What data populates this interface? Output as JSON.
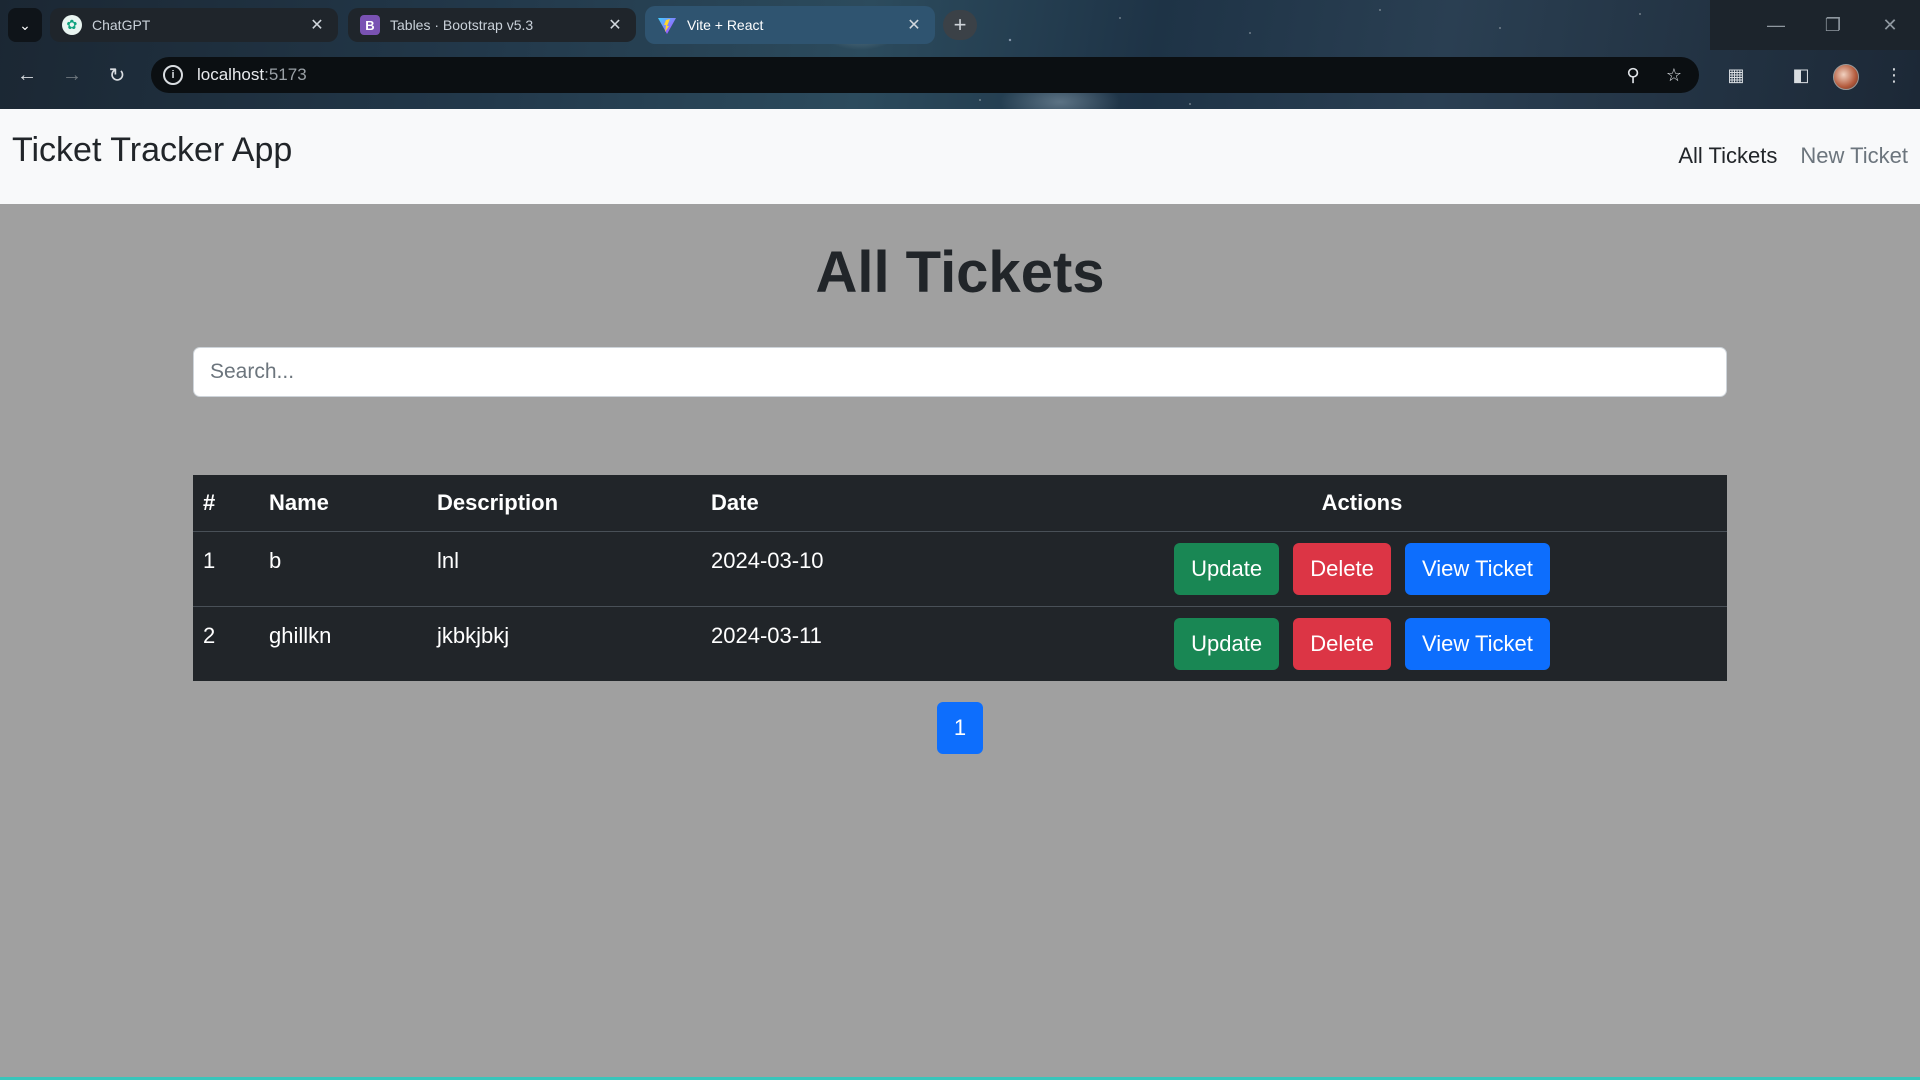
{
  "browser": {
    "tabs": [
      {
        "title": "ChatGPT",
        "favicon": "chatgpt-icon"
      },
      {
        "title": "Tables · Bootstrap v5.3",
        "favicon": "bootstrap-icon",
        "favicon_text": "B"
      },
      {
        "title": "Vite + React",
        "favicon": "vite-icon"
      }
    ],
    "url_host": "localhost",
    "url_port": ":5173"
  },
  "app": {
    "brand": "Ticket Tracker App",
    "nav": {
      "all_tickets": "All Tickets",
      "new_ticket": "New Ticket"
    },
    "page_title": "All Tickets",
    "search": {
      "placeholder": "Search...",
      "value": ""
    },
    "table": {
      "headers": [
        "#",
        "Name",
        "Description",
        "Date",
        "Actions"
      ],
      "rows": [
        {
          "id": "1",
          "name": "b",
          "description": "lnl",
          "date": "2024-03-10"
        },
        {
          "id": "2",
          "name": "ghillkn",
          "description": "jkbkjbkj",
          "date": "2024-03-11"
        }
      ],
      "actions": {
        "update": "Update",
        "delete": "Delete",
        "view": "View Ticket"
      }
    },
    "pagination": {
      "current_page": "1"
    }
  },
  "colors": {
    "navbar_bg": "#f8f9fa",
    "page_bg": "#a0a0a0",
    "table_bg": "#212529",
    "success": "#198754",
    "danger": "#dc3545",
    "primary": "#0d6efd"
  }
}
